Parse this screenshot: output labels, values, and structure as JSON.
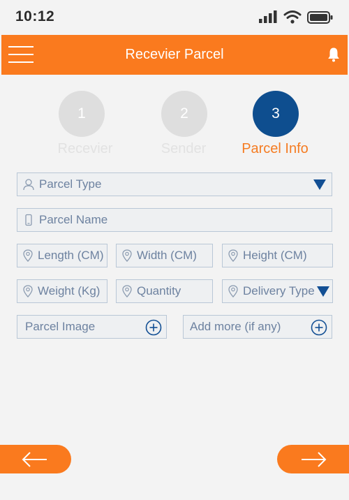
{
  "status_bar": {
    "time": "10:12"
  },
  "app_bar": {
    "title": "Recevier Parcel"
  },
  "steps": [
    {
      "number": "1",
      "label": "Recevier"
    },
    {
      "number": "2",
      "label": "Sender"
    },
    {
      "number": "3",
      "label": "Parcel Info"
    }
  ],
  "form": {
    "parcel_type": "Parcel Type",
    "parcel_name": "Parcel Name",
    "length": "Length (CM)",
    "width": "Width (CM)",
    "height": "Height (CM)",
    "weight": "Weight (Kg)",
    "quantity": "Quantity",
    "delivery_type": "Delivery Type",
    "parcel_image": "Parcel Image",
    "add_more": "Add more (if any)"
  },
  "colors": {
    "accent": "#fa7a1e",
    "primary": "#0e4e8f",
    "inactive_step": "#dedede"
  }
}
